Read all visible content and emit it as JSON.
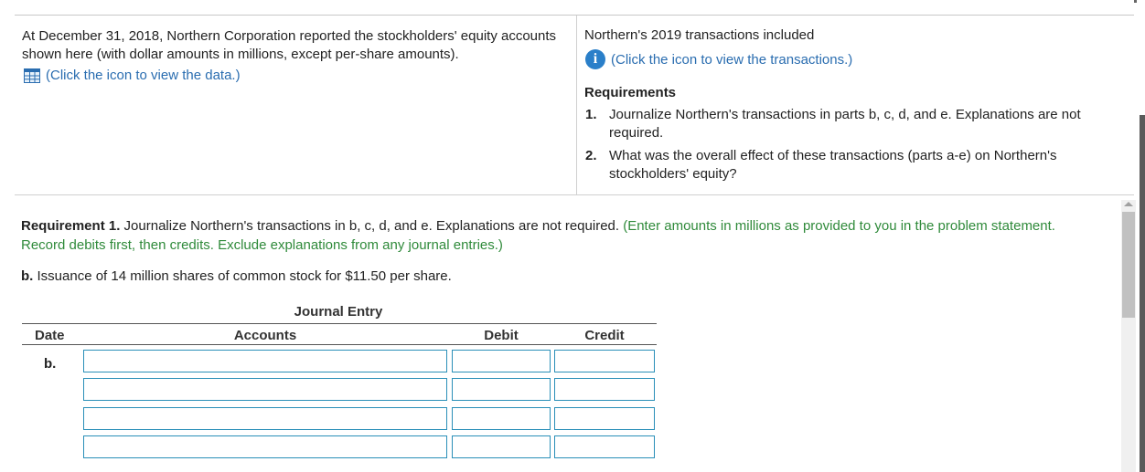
{
  "intro": {
    "text": "At December 31, 2018, Northern Corporation reported the stockholders' equity accounts shown here (with dollar amounts in millions, except per-share amounts).",
    "data_link": "(Click the icon to view the data.)"
  },
  "transactions": {
    "heading": "Northern's 2019 transactions included",
    "link": "(Click the icon to view the transactions.)"
  },
  "requirements": {
    "title": "Requirements",
    "items": [
      {
        "num": "1.",
        "text": "Journalize Northern's transactions in parts b, c, d, and e. Explanations are not required."
      },
      {
        "num": "2.",
        "text": "What was the overall effect of these transactions (parts a-e) on Northern's stockholders' equity?"
      }
    ]
  },
  "requirement1": {
    "label": "Requirement 1.",
    "text": " Journalize Northern's transactions in b, c, d, and e. Explanations are not required. ",
    "instruction": "(Enter amounts in millions as provided to you in the problem statement. Record debits first, then credits. Exclude explanations from any journal entries.)"
  },
  "part_b": {
    "label": "b.",
    "text": " Issuance of 14 million shares of common stock for $11.50 per share."
  },
  "journal": {
    "title": "Journal Entry",
    "headers": {
      "date": "Date",
      "accounts": "Accounts",
      "debit": "Debit",
      "credit": "Credit"
    },
    "row_label": "b.",
    "rows": [
      {
        "account": "",
        "debit": "",
        "credit": ""
      },
      {
        "account": "",
        "debit": "",
        "credit": ""
      },
      {
        "account": "",
        "debit": "",
        "credit": ""
      },
      {
        "account": "",
        "debit": "",
        "credit": ""
      }
    ]
  },
  "colors": {
    "link": "#2a6db0",
    "instruction_green": "#2f8a3a",
    "input_border": "#2a8fb8",
    "info_icon": "#2a7fc9"
  },
  "icons": {
    "data": "table-grid-icon",
    "transactions": "info-icon"
  }
}
